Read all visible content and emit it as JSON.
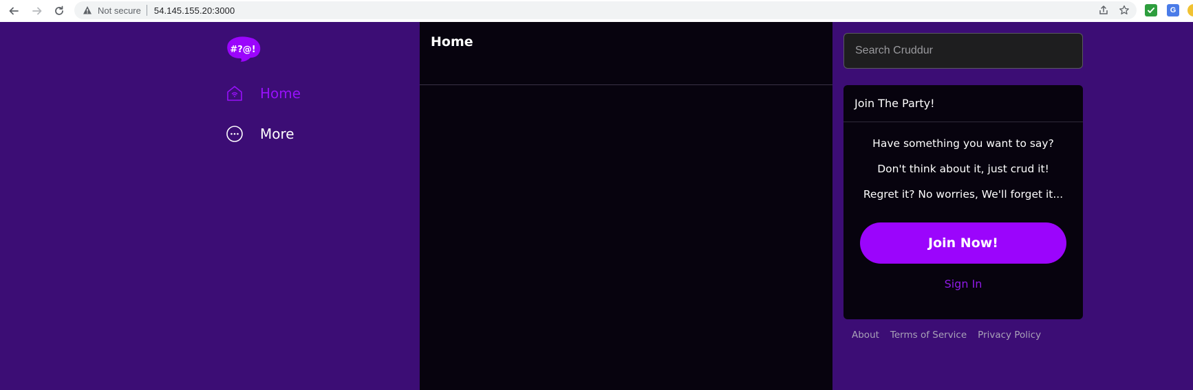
{
  "browser": {
    "security_label": "Not secure",
    "url": "54.145.155.20:3000",
    "icons": [
      "back-arrow-icon",
      "forward-arrow-icon",
      "reload-icon",
      "warning-icon",
      "share-icon",
      "star-icon",
      "checkmark-extension-icon",
      "translate-extension-icon"
    ]
  },
  "sidebar": {
    "logo_text": "#?@!",
    "items": [
      {
        "label": "Home",
        "icon": "home-icon",
        "active": true
      },
      {
        "label": "More",
        "icon": "more-circle-icon",
        "active": false
      }
    ]
  },
  "feed": {
    "title": "Home"
  },
  "search": {
    "placeholder": "Search Cruddur",
    "value": ""
  },
  "join_card": {
    "title": "Join The Party!",
    "lines": [
      "Have something you want to say?",
      "Don't think about it, just crud it!",
      "Regret it? No worries, We'll forget it..."
    ],
    "join_button": "Join Now!",
    "signin_link": "Sign In"
  },
  "footer": {
    "links": [
      "About",
      "Terms of Service",
      "Privacy Policy"
    ]
  },
  "colors": {
    "page_background": "#3c0d75",
    "feed_background": "#07030e",
    "accent": "#9b05fc",
    "active_nav": "#9810fa"
  }
}
